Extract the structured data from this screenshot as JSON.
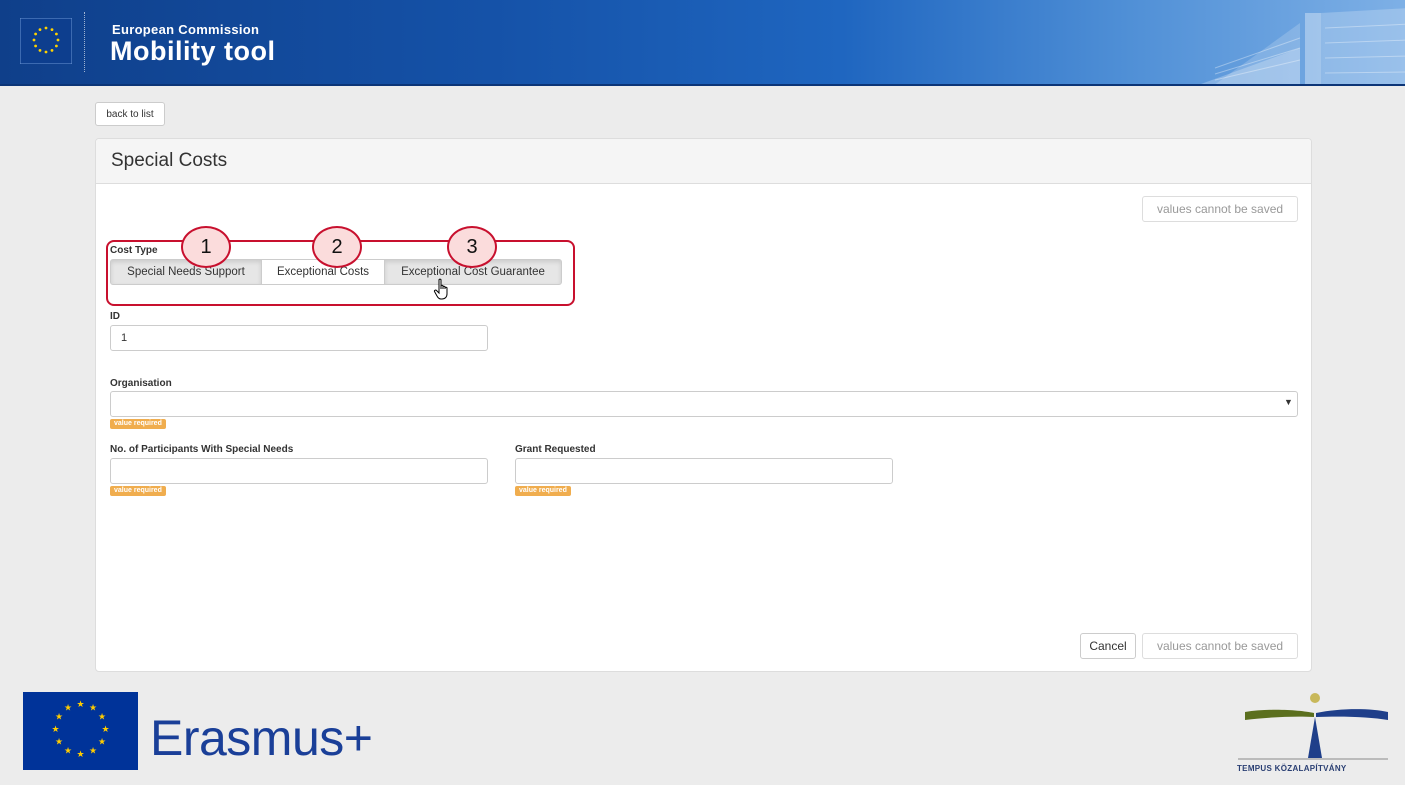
{
  "header": {
    "subtitle": "European Commission",
    "title": "Mobility tool"
  },
  "back_button": "back to list",
  "panel": {
    "title": "Special Costs",
    "save_top_label": "values cannot be saved",
    "cost_type": {
      "label": "Cost Type",
      "options": [
        "Special Needs Support",
        "Exceptional Costs",
        "Exceptional Cost Guarantee"
      ],
      "selected": "Exceptional Costs"
    },
    "callouts": [
      "1",
      "2",
      "3"
    ],
    "id_field": {
      "label": "ID",
      "value": "1"
    },
    "organisation": {
      "label": "Organisation",
      "value": "",
      "badge": "value required"
    },
    "participants": {
      "label": "No. of Participants With Special Needs",
      "value": "",
      "badge": "value required"
    },
    "grant": {
      "label": "Grant Requested",
      "value": "",
      "badge": "value required"
    },
    "cancel_label": "Cancel",
    "save_bottom_label": "values cannot be saved"
  },
  "footer": {
    "erasmus_text": "Erasmus+",
    "tempus_text": "TEMPUS KÖZALAPÍTVÁNY"
  },
  "colors": {
    "header_blue": "#1552a8",
    "annotation_red": "#c8102e",
    "badge_orange": "#f0ad4e",
    "erasmus_blue": "#1a3f98"
  },
  "icons": [
    "eu-flag-icon",
    "building-graphic",
    "hand-pointer-icon",
    "dropdown-caret-icon",
    "tempus-logo-icon"
  ]
}
